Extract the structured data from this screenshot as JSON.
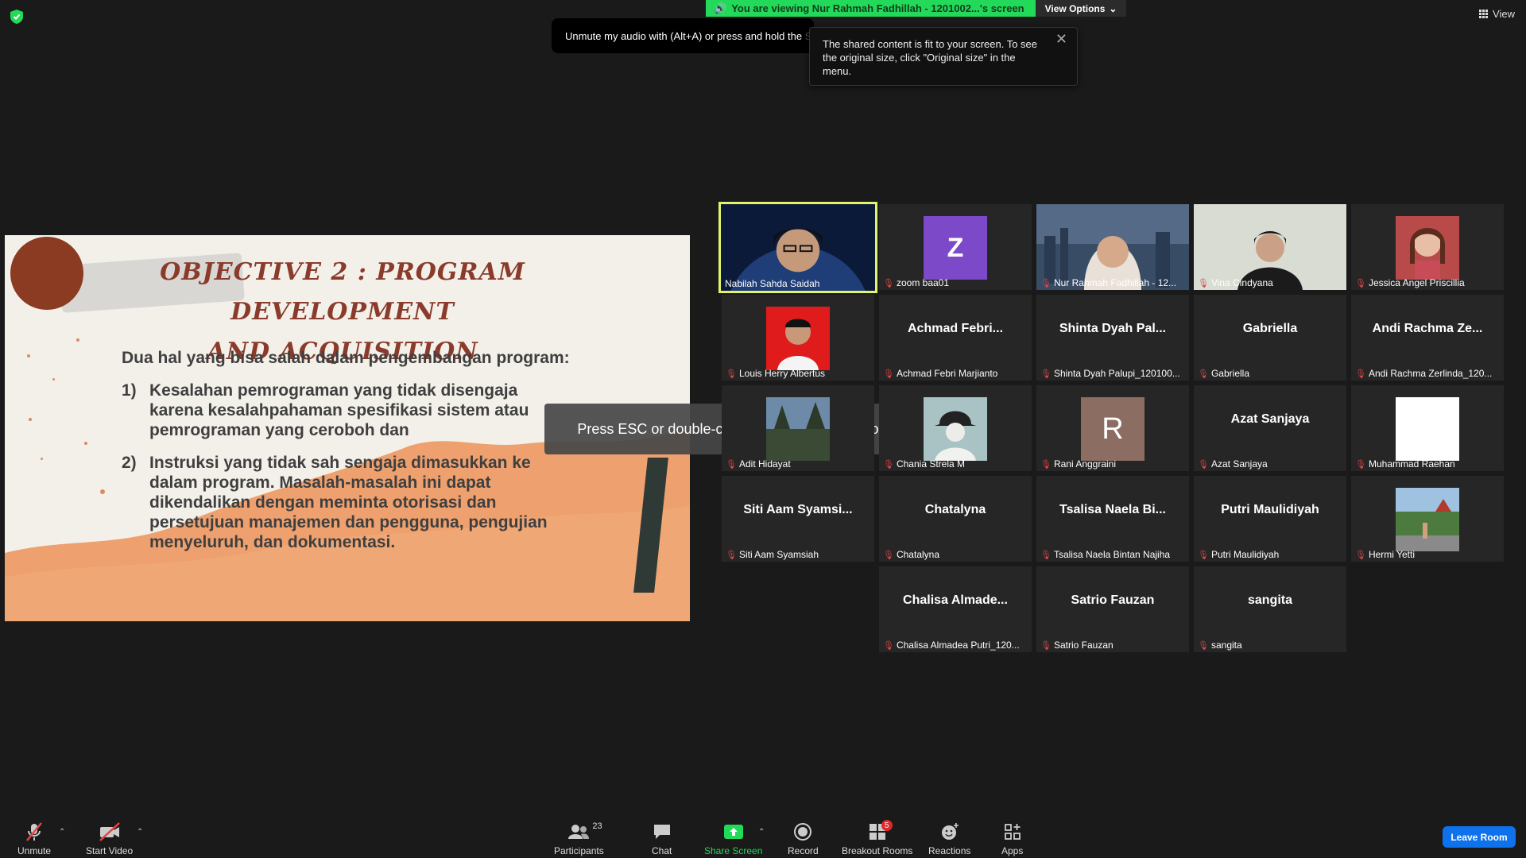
{
  "topbar": {
    "viewing_banner": "You are viewing Nur Rahmah Fadhillah - 1201002...'s screen",
    "view_options": "View Options",
    "view_button": "View",
    "unmute_tip": "Unmute my audio with (Alt+A) or press and hold the",
    "unmute_tip_ghost": "SPACE key to temporarily unmute",
    "fit_tip": "The shared content is fit to your screen. To see the original size, click \"Original size\" in the menu."
  },
  "slide": {
    "title_line1": "OBJECTIVE 2 : PROGRAM DEVELOPMENT",
    "title_line2": "AND ACQUISITION",
    "intro": "Dua hal yang bisa salah dalam pengembangan program:",
    "items": [
      {
        "num": "1)",
        "text": "Kesalahan pemrograman yang tidak disengaja karena kesalahpahaman spesifikasi sistem atau pemrograman yang ceroboh dan"
      },
      {
        "num": "2)",
        "text": "Instruksi yang tidak sah sengaja dimasukkan ke dalam program. Masalah-masalah ini dapat dikendalikan dengan meminta otorisasi dan persetujuan manajemen dan pengguna, pengujian menyeluruh, dan dokumentasi."
      }
    ]
  },
  "fullscreen_message": "Press ESC or double-click to exit full screen mode",
  "gallery": [
    {
      "name": "Nabilah Sahda Saidah",
      "big": "",
      "kind": "photo"
    },
    {
      "name": "zoom baa01",
      "big": "Z",
      "kind": "letter-purple"
    },
    {
      "name": "Nur Rahmah Fadhillah - 12...",
      "big": "",
      "kind": "photo"
    },
    {
      "name": "Vina Cindyana",
      "big": "",
      "kind": "photo"
    },
    {
      "name": "Jessica Angel Priscillia",
      "big": "",
      "kind": "photo-small"
    },
    {
      "name": "Louis Herry Albertus",
      "big": "",
      "kind": "photo-red"
    },
    {
      "name": "Achmad Febri Marjianto",
      "big": "Achmad Febri...",
      "kind": "text"
    },
    {
      "name": "Shinta Dyah Palupi_120100...",
      "big": "Shinta Dyah Pal...",
      "kind": "text"
    },
    {
      "name": "Gabriella",
      "big": "Gabriella",
      "kind": "text"
    },
    {
      "name": "Andi Rachma Zerlinda_120...",
      "big": "Andi Rachma Ze...",
      "kind": "text"
    },
    {
      "name": "Adit Hidayat",
      "big": "",
      "kind": "photo-small"
    },
    {
      "name": "Chania Strela M",
      "big": "",
      "kind": "photo-small"
    },
    {
      "name": "Rani Anggraini",
      "big": "R",
      "kind": "letter-brown"
    },
    {
      "name": "Azat Sanjaya",
      "big": "Azat Sanjaya",
      "kind": "text"
    },
    {
      "name": "Muhammad Raehan",
      "big": "",
      "kind": "white"
    },
    {
      "name": "Siti Aam Syamsiah",
      "big": "Siti Aam Syamsi...",
      "kind": "text"
    },
    {
      "name": "Chatalyna",
      "big": "Chatalyna",
      "kind": "text"
    },
    {
      "name": "Tsalisa Naela Bintan Najiha",
      "big": "Tsalisa Naela Bi...",
      "kind": "text"
    },
    {
      "name": "Putri Maulidiyah",
      "big": "Putri Maulidiyah",
      "kind": "text"
    },
    {
      "name": "Hermi Yetti",
      "big": "",
      "kind": "photo-small"
    },
    {
      "name": "Chalisa Almadea Putri_120...",
      "big": "Chalisa Almade...",
      "kind": "text"
    },
    {
      "name": "Satrio Fauzan",
      "big": "Satrio Fauzan",
      "kind": "text"
    },
    {
      "name": "sangita",
      "big": "sangita",
      "kind": "text"
    }
  ],
  "toolbar": {
    "unmute": "Unmute",
    "start_video": "Start Video",
    "participants": "Participants",
    "participants_count": "23",
    "chat": "Chat",
    "share_screen": "Share Screen",
    "record": "Record",
    "breakout_rooms": "Breakout Rooms",
    "breakout_badge": "5",
    "reactions": "Reactions",
    "apps": "Apps",
    "leave_room": "Leave Room"
  },
  "colors": {
    "active_speaker": "#e1f56c",
    "share_green": "#23d959",
    "leave_blue": "#0e72ed",
    "muted_red": "#e24545"
  }
}
